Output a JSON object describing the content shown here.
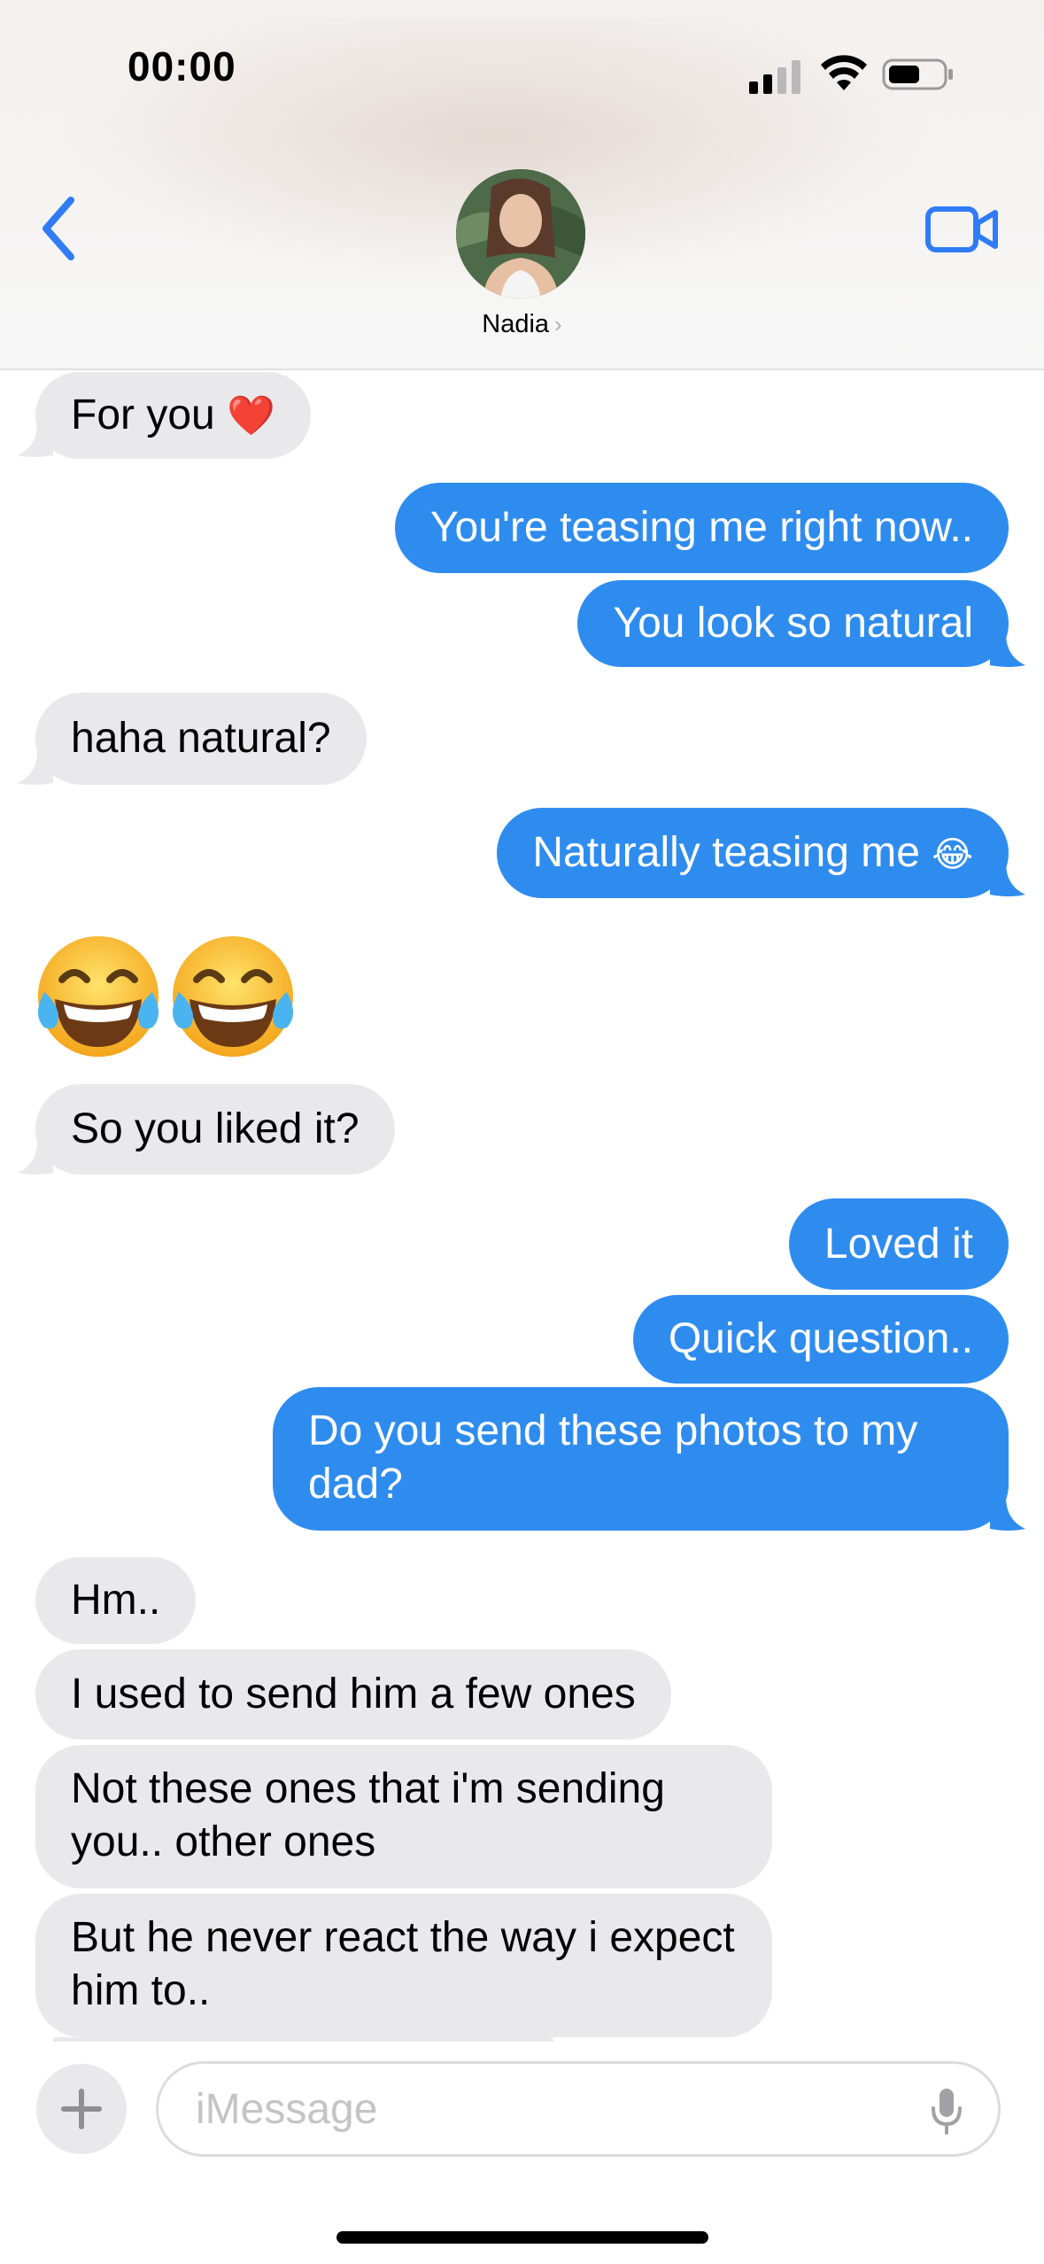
{
  "status_bar": {
    "time": "00:00"
  },
  "header": {
    "contact_name": "Nadia",
    "name_chevron": "›"
  },
  "icons": {
    "back": "chevron-left-icon",
    "video": "video-camera-icon",
    "add": "plus-icon",
    "mic": "microphone-icon"
  },
  "messages": [
    {
      "direction": "received",
      "text": "For you",
      "emoji": "❤️"
    },
    {
      "direction": "sent",
      "text": "You're teasing me right now.."
    },
    {
      "direction": "sent",
      "text": "You look so natural"
    },
    {
      "direction": "received",
      "text": "haha natural?"
    },
    {
      "direction": "sent",
      "text": "Naturally teasing me",
      "emoji": "😂"
    },
    {
      "direction": "received",
      "text": "",
      "emoji": "😂😂"
    },
    {
      "direction": "received",
      "text": "So you liked it?"
    },
    {
      "direction": "sent",
      "text": "Loved it"
    },
    {
      "direction": "sent",
      "text": "Quick question.."
    },
    {
      "direction": "sent",
      "text": "Do you send these photos to my dad?"
    },
    {
      "direction": "received",
      "text": "Hm.."
    },
    {
      "direction": "received",
      "text": "I used to send him a few ones"
    },
    {
      "direction": "received",
      "text": "Not these ones that i'm sending you.. other ones"
    },
    {
      "direction": "received",
      "text": "But he never react the way i expect him to.."
    }
  ],
  "composer": {
    "placeholder": "iMessage"
  },
  "colors": {
    "sent_bubble": "#2f8cef",
    "received_bubble": "#e9e9eb",
    "accent": "#2f7cf6"
  }
}
